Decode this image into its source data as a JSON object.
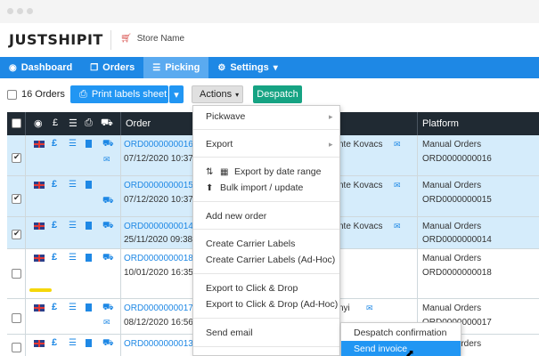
{
  "brand": {
    "logo": "JUSTSHIPIT",
    "store_name": "Store Name",
    "colors": {
      "nav": "#1e88e5",
      "accent": "#2196f3",
      "despatch": "#16a383",
      "header": "#202a33"
    }
  },
  "nav": {
    "items": [
      {
        "label": "Dashboard",
        "icon": "tachometer-icon"
      },
      {
        "label": "Orders",
        "icon": "clone-icon"
      },
      {
        "label": "Picking",
        "icon": "list-icon",
        "active": true
      },
      {
        "label": "Settings",
        "icon": "gear-icon",
        "dropdown": true
      }
    ]
  },
  "toolbar": {
    "count_label": "16 Orders",
    "print_label": "Print labels sheet",
    "actions_label": "Actions",
    "despatch_label": "Despatch"
  },
  "table": {
    "headers": {
      "order": "Order",
      "platform": "Platform"
    },
    "rows": [
      {
        "selected": true,
        "order": "ORD0000000016",
        "date": "07/12/2020 10:37",
        "customer": "nte Kovacs",
        "platform": "Manual Orders",
        "platform_ref": "ORD0000000016"
      },
      {
        "selected": true,
        "order": "ORD0000000015",
        "date": "07/12/2020 10:37",
        "customer": "nte Kovacs",
        "platform": "Manual Orders",
        "platform_ref": "ORD0000000015"
      },
      {
        "selected": true,
        "order": "ORD0000000014",
        "date": "25/11/2020 09:38",
        "customer": "nte Kovacs",
        "platform": "Manual Orders",
        "platform_ref": "ORD0000000014"
      },
      {
        "selected": false,
        "order": "ORD0000000018",
        "date": "10/01/2020 16:35",
        "customer": "",
        "platform": "Manual Orders",
        "platform_ref": "ORD0000000018"
      },
      {
        "selected": false,
        "order": "ORD0000000017",
        "date": "08/12/2020 16:56",
        "customer": "nyi",
        "platform": "Manual Orders",
        "platform_ref": "ORD0000000017"
      },
      {
        "selected": false,
        "order": "ORD0000000013",
        "date": "",
        "customer": "",
        "platform": "Manual Orders",
        "platform_ref": ""
      }
    ]
  },
  "actions_menu": {
    "pickwave": "Pickwave",
    "export": "Export",
    "export_date_range": "Export by date range",
    "bulk_import": "Bulk import / update",
    "add_order": "Add new order",
    "create_labels": "Create Carrier Labels",
    "create_labels_adhoc": "Create Carrier Labels (Ad-Hoc)",
    "export_click_drop": "Export to Click & Drop",
    "export_click_drop_adhoc": "Export to Click & Drop (Ad-Hoc)",
    "send_email": "Send email"
  },
  "email_submenu": {
    "despatch_confirmation": "Despatch confirmation",
    "send_invoice": "Send invoice"
  }
}
